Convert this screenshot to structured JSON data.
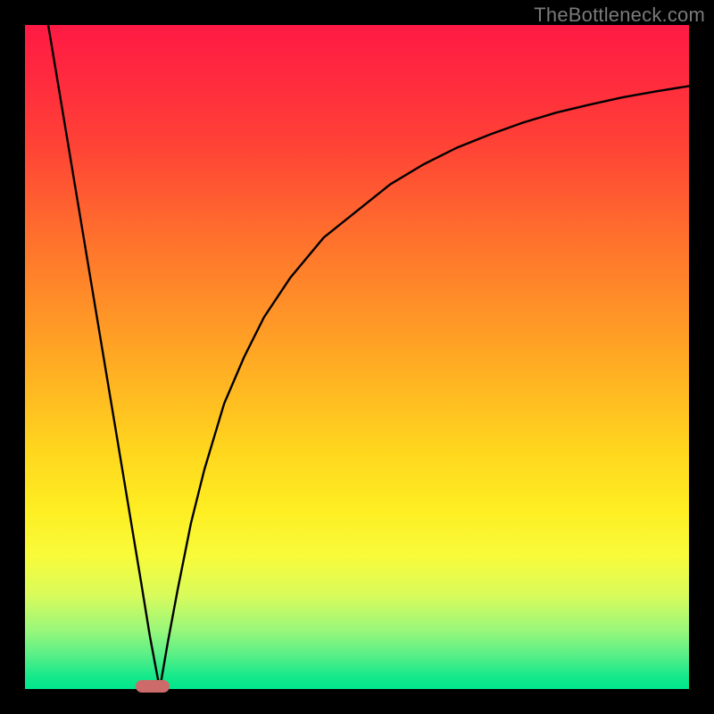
{
  "watermark": "TheBottleneck.com",
  "marker": {
    "x_frac": 0.192,
    "width_frac": 0.052,
    "color": "#cc6b69"
  },
  "chart_data": {
    "type": "line",
    "title": "",
    "xlabel": "",
    "ylabel": "",
    "xlim": [
      0,
      100
    ],
    "ylim": [
      0,
      100
    ],
    "grid": false,
    "legend": false,
    "note": "Values estimated from pixel positions; y=0 is bottom (green), y=100 is top (red). Two branches meet at the minimum near x≈20.",
    "series": [
      {
        "name": "left-branch",
        "x": [
          3.5,
          5,
          7.5,
          10,
          12.5,
          15,
          17.5,
          18.8,
          20.3
        ],
        "y": [
          100,
          91,
          76,
          61,
          46,
          31,
          16,
          8,
          0
        ]
      },
      {
        "name": "right-branch",
        "x": [
          20.3,
          21.5,
          23,
          25,
          27,
          30,
          33,
          36,
          40,
          45,
          50,
          55,
          60,
          65,
          70,
          75,
          80,
          85,
          90,
          95,
          100
        ],
        "y": [
          0,
          7,
          15,
          25,
          33,
          43,
          50,
          56,
          62,
          68,
          72,
          76,
          79,
          81.5,
          83.5,
          85.3,
          86.8,
          88,
          89.1,
          90,
          90.8
        ]
      }
    ],
    "optimal_region": {
      "x_start": 17.5,
      "x_end": 22.5
    }
  }
}
